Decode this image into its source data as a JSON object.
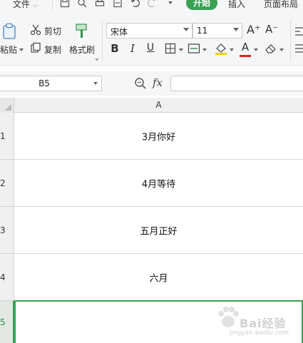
{
  "menu": {
    "file": "文件",
    "tabs": {
      "start": "开始",
      "insert": "插入",
      "page_layout": "页面布局"
    }
  },
  "ribbon": {
    "paste_label": "粘贴",
    "cut_label": "剪切",
    "copy_label": "复制",
    "format_painter_label": "格式刷",
    "font_name": "宋体",
    "font_size": "11",
    "bold": "B",
    "italic": "I",
    "underline": "U",
    "grow_font": "A⁺",
    "shrink_font": "A⁻",
    "font_color_letter": "A",
    "colors": {
      "accent": "#3aa153",
      "font_color": "#e02020",
      "fill_color": "#f5d200"
    }
  },
  "formula_bar": {
    "name_box": "B5",
    "fx_label": "fx",
    "formula_value": ""
  },
  "grid": {
    "column_header": "A",
    "rows": [
      {
        "number": "1",
        "value": "3月你好"
      },
      {
        "number": "2",
        "value": "4月等待"
      },
      {
        "number": "3",
        "value": "五月正好"
      },
      {
        "number": "4",
        "value": "六月"
      },
      {
        "number": "5",
        "value": ""
      }
    ]
  },
  "watermark": {
    "text": "Bai经验",
    "sub": "jingyan.baidu.com"
  }
}
